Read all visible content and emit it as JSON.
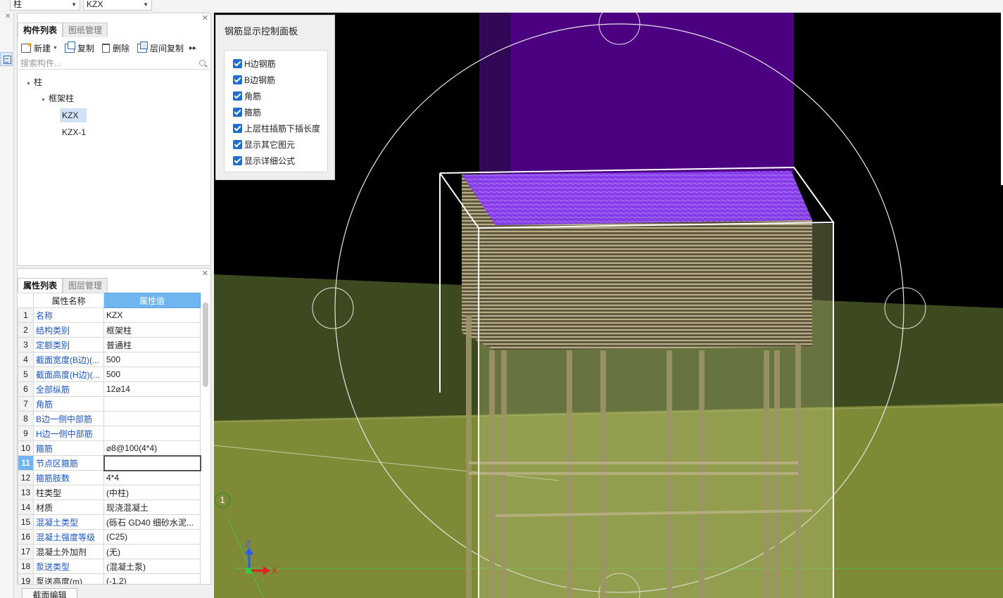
{
  "topbar": {
    "type_select": "柱",
    "component_select": "KZX"
  },
  "component_panel": {
    "tabs": [
      "构件列表",
      "图纸管理"
    ],
    "toolbar": {
      "new": "新建",
      "copy": "复制",
      "delete": "删除",
      "floor_copy": "层间复制"
    },
    "search_placeholder": "搜索构件...",
    "tree": {
      "root": "柱",
      "group": "框架柱",
      "items": [
        "KZX",
        "KZX-1"
      ]
    }
  },
  "property_panel": {
    "tabs": [
      "属性列表",
      "图层管理"
    ],
    "headers": {
      "name": "属性名称",
      "value": "属性值"
    },
    "rows": [
      {
        "n": "1",
        "name": "名称",
        "value": "KZX"
      },
      {
        "n": "2",
        "name": "结构类别",
        "value": "框架柱"
      },
      {
        "n": "3",
        "name": "定额类别",
        "value": "普通柱"
      },
      {
        "n": "4",
        "name": "截面宽度(B边)(...",
        "value": "500"
      },
      {
        "n": "5",
        "name": "截面高度(H边)(...",
        "value": "500"
      },
      {
        "n": "6",
        "name": "全部纵筋",
        "value": "12⌀14"
      },
      {
        "n": "7",
        "name": "角筋",
        "value": ""
      },
      {
        "n": "8",
        "name": "B边一侧中部筋",
        "value": ""
      },
      {
        "n": "9",
        "name": "H边一侧中部筋",
        "value": ""
      },
      {
        "n": "10",
        "name": "箍筋",
        "value": "⌀8@100(4*4)"
      },
      {
        "n": "11",
        "name": "节点区箍筋",
        "value": ""
      },
      {
        "n": "12",
        "name": "箍筋肢数",
        "value": "4*4"
      },
      {
        "n": "13",
        "name": "柱类型",
        "value": "(中柱)"
      },
      {
        "n": "14",
        "name": "材质",
        "value": "现浇混凝土"
      },
      {
        "n": "15",
        "name": "混凝土类型",
        "value": "(砾石 GD40 细砂水泥..."
      },
      {
        "n": "16",
        "name": "混凝土强度等级",
        "value": "(C25)"
      },
      {
        "n": "17",
        "name": "混凝土外加剂",
        "value": "(无)"
      },
      {
        "n": "18",
        "name": "泵送类型",
        "value": "(混凝土泵)"
      },
      {
        "n": "19",
        "name": "泵送高度(m)",
        "value": "(-1.2)"
      }
    ],
    "bottom_button": "截面编辑"
  },
  "rebar_panel": {
    "title": "钢筋显示控制面板",
    "options": [
      "H边钢筋",
      "B边钢筋",
      "角筋",
      "箍筋",
      "上层柱插筋下插长度",
      "显示其它图元",
      "显示详细公式"
    ]
  },
  "viewport": {
    "axis_z": "Z",
    "axis_x": "X",
    "grid_marker": "1"
  },
  "colors": {
    "accent": "#6fb6f0",
    "link": "#1c55c8",
    "column": "#7a1de8",
    "ground": "#7d8a2f"
  }
}
